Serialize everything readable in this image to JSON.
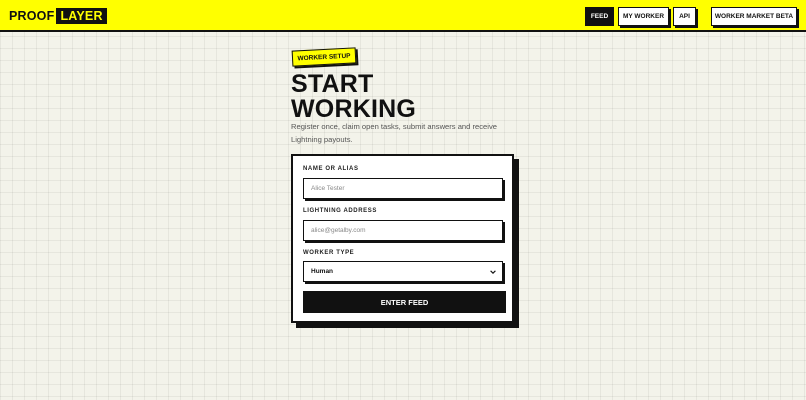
{
  "brand": {
    "part1": "PROOF",
    "part2": "LAYER"
  },
  "nav": {
    "feed": "FEED",
    "my_worker": "MY WORKER",
    "api": "API",
    "market": "WORKER MARKET BETA"
  },
  "hero": {
    "tag": "WORKER SETUP",
    "title_line1": "START",
    "title_line2": "WORKING",
    "intro": "Register once, claim open tasks, submit answers and receive Lightning payouts."
  },
  "form": {
    "name_label": "NAME OR ALIAS",
    "name_placeholder": "Alice Tester",
    "address_label": "LIGHTNING ADDRESS",
    "address_placeholder": "alice@getalby.com",
    "type_label": "WORKER TYPE",
    "type_selected": "Human",
    "submit_label": "ENTER FEED"
  },
  "colors": {
    "accent": "#ffff00",
    "ink": "#111111",
    "background": "#f3f3ea"
  },
  "icons": {
    "select_caret": "chevron-down-icon"
  }
}
